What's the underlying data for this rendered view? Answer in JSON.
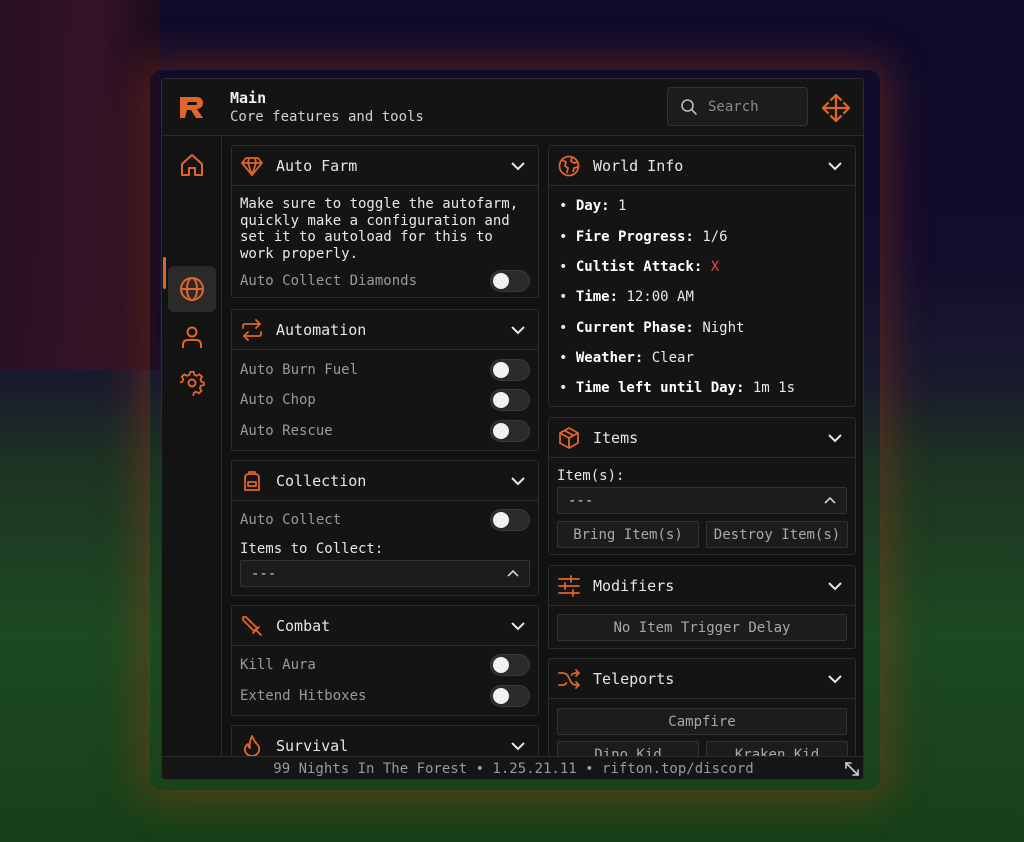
{
  "header": {
    "title": "Main",
    "subtitle": "Core features and tools",
    "search_placeholder": "Search"
  },
  "colors": {
    "accent": "#e0652b",
    "bg": "#121212",
    "danger": "#e04848"
  },
  "sidebar": {
    "items": [
      {
        "name": "home",
        "icon": "home-icon",
        "active": false
      },
      {
        "name": "world",
        "icon": "globe-icon",
        "active": true
      },
      {
        "name": "player",
        "icon": "user-icon",
        "active": false
      },
      {
        "name": "settings",
        "icon": "gear-icon",
        "active": false
      }
    ]
  },
  "auto_farm": {
    "title": "Auto Farm",
    "description": "Make sure to toggle the autofarm, quickly make a configuration and set it to autoload for this to work properly.",
    "toggles": [
      "Auto Collect Diamonds"
    ]
  },
  "automation": {
    "title": "Automation",
    "toggles": [
      "Auto Burn Fuel",
      "Auto Chop",
      "Auto Rescue"
    ]
  },
  "collection": {
    "title": "Collection",
    "toggles": [
      "Auto Collect"
    ],
    "items_label": "Items to Collect:",
    "dropdown_value": "---"
  },
  "combat": {
    "title": "Combat",
    "toggles": [
      "Kill Aura",
      "Extend Hitboxes"
    ]
  },
  "survival": {
    "title": "Survival"
  },
  "world_info": {
    "title": "World Info",
    "lines": [
      {
        "key": "Day:",
        "value": "1"
      },
      {
        "key": "Fire Progress:",
        "value": "1/6"
      },
      {
        "key": "Cultist Attack:",
        "value": "X"
      },
      {
        "key": "Time:",
        "value": "12:00 AM"
      },
      {
        "key": "Current Phase:",
        "value": "Night"
      },
      {
        "key": "Weather:",
        "value": "Clear"
      },
      {
        "key": "Time left until Day:",
        "value": "1m 1s"
      }
    ]
  },
  "items": {
    "title": "Items",
    "label": "Item(s):",
    "dropdown_value": "---",
    "bring_label": "Bring Item(s)",
    "destroy_label": "Destroy Item(s)"
  },
  "modifiers": {
    "title": "Modifiers",
    "button_label": "No Item Trigger Delay"
  },
  "teleports": {
    "title": "Teleports",
    "buttons": [
      "Campfire",
      "Dino Kid",
      "Kraken Kid"
    ]
  },
  "footer": {
    "text": "99 Nights In The Forest • 1.25.21.11 • rifton.top/discord"
  }
}
